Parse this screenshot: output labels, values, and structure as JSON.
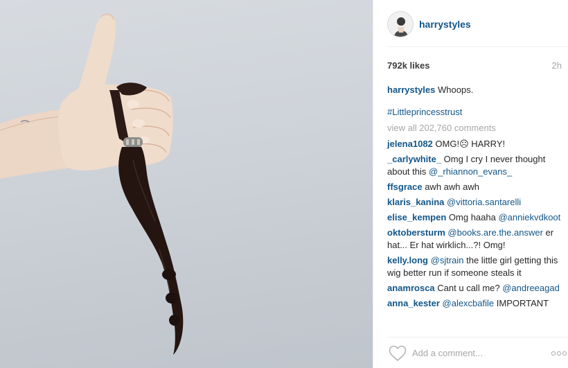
{
  "post": {
    "username": "harrystyles",
    "likes": "792k likes",
    "time": "2h",
    "caption": {
      "user": "harrystyles",
      "text": "Whoops."
    },
    "hashtag": "#Littleprincesstrust",
    "view_all_comments": "view all 202,760 comments",
    "comments": [
      {
        "user": "jelena1082",
        "text": "OMG!☹ HARRY!",
        "mention": ""
      },
      {
        "user": "_carlywhite_",
        "text": "Omg I cry I never thought about this",
        "mention": "@_rhiannon_evans_"
      },
      {
        "user": "ffsgrace",
        "text": "awh awh awh",
        "mention": ""
      },
      {
        "user": "klaris_kanina",
        "text": "",
        "mention": "@vittoria.santarelli"
      },
      {
        "user": "elise_kempen",
        "text": "Omg haaha",
        "mention": "@anniekvdkoot"
      },
      {
        "user": "oktobersturm",
        "text": "er hat... Er hat wirklich...?! Omg!",
        "mention": "@books.are.the.answer"
      },
      {
        "user": "kelly.long",
        "text": "the little girl getting this wig better run if someone steals it",
        "mention": "@sjtrain"
      },
      {
        "user": "anamrosca",
        "text": "Cant u call me?",
        "mention": "@andreeagad"
      },
      {
        "user": "anna_kester",
        "text": "IMPORTANT",
        "mention": "@alexcbafile"
      }
    ],
    "comment_placeholder": "Add a comment...",
    "icons": {
      "like": "heart-icon",
      "options": "more-options-icon",
      "avatar": "avatar-icon"
    }
  }
}
